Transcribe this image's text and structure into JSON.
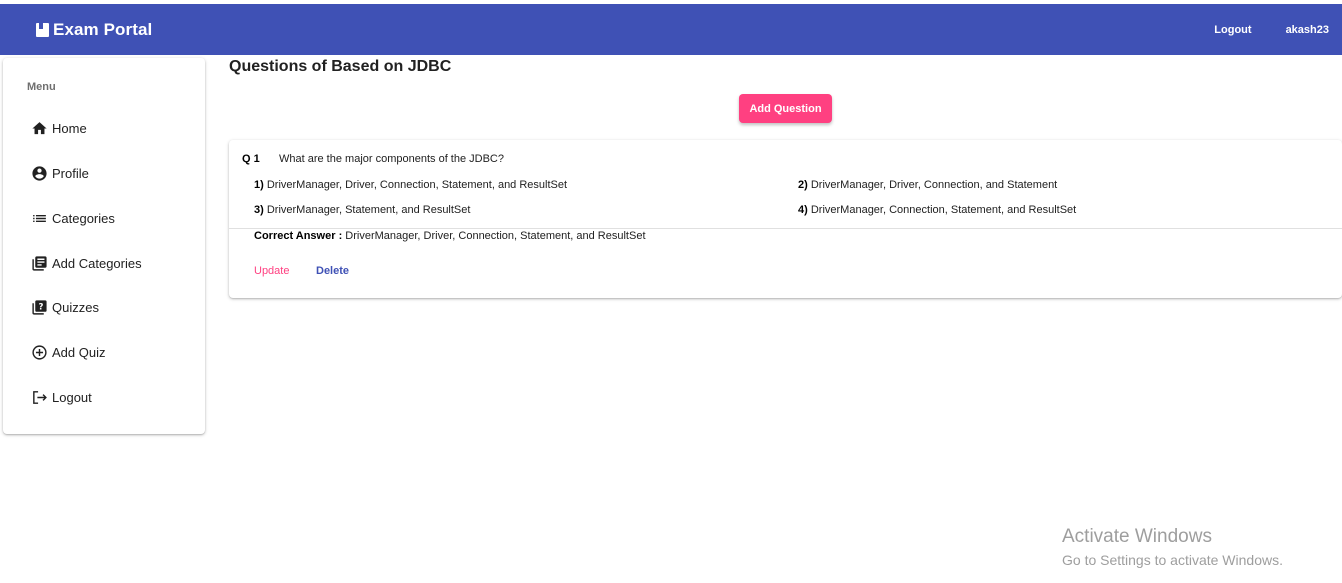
{
  "navbar": {
    "title": "Exam Portal",
    "logout_label": "Logout",
    "username": "akash23"
  },
  "sidebar": {
    "menu_label": "Menu",
    "items": [
      {
        "label": "Home",
        "icon": "home-icon"
      },
      {
        "label": "Profile",
        "icon": "account-circle-icon"
      },
      {
        "label": "Categories",
        "icon": "list-icon"
      },
      {
        "label": "Add Categories",
        "icon": "library-books-icon"
      },
      {
        "label": "Quizzes",
        "icon": "quiz-icon"
      },
      {
        "label": "Add Quiz",
        "icon": "add-circle-icon"
      },
      {
        "label": "Logout",
        "icon": "logout-icon"
      }
    ]
  },
  "main": {
    "page_title": "Questions of Based on JDBC",
    "add_question_label": "Add Question",
    "questions": [
      {
        "number": "Q 1",
        "text": "What are the major components of the JDBC?",
        "options": [
          {
            "num": "1)",
            "text": "DriverManager, Driver, Connection, Statement, and ResultSet"
          },
          {
            "num": "2)",
            "text": "DriverManager, Driver, Connection, and Statement"
          },
          {
            "num": "3)",
            "text": "DriverManager, Statement, and ResultSet"
          },
          {
            "num": "4)",
            "text": "DriverManager, Connection, Statement, and ResultSet"
          }
        ],
        "answer_label": "Correct Answer :",
        "answer": "DriverManager, Driver, Connection, Statement, and ResultSet",
        "update_label": "Update",
        "delete_label": "Delete"
      }
    ]
  },
  "watermark": {
    "title": "Activate Windows",
    "subtitle": "Go to Settings to activate Windows."
  },
  "colors": {
    "primary": "#3f51b5",
    "accent": "#ff4081"
  }
}
